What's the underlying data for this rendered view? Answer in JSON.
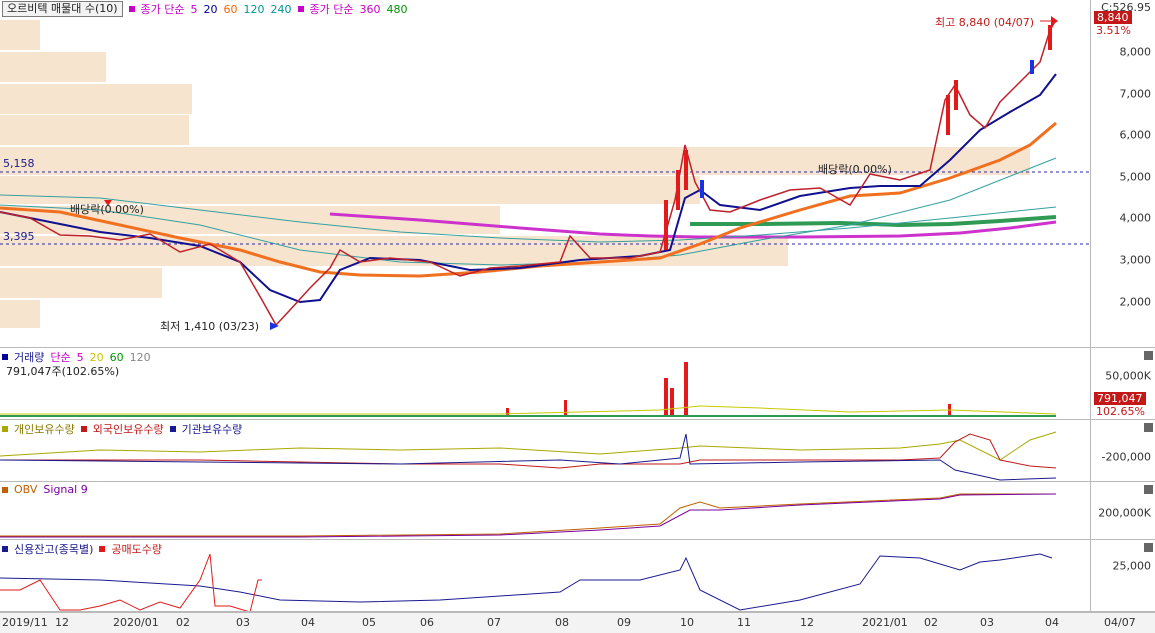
{
  "main": {
    "title_button": "오르비텍 매물대 수(10)",
    "ma_label": "종가 단순",
    "ma_periods": [
      "5",
      "20",
      "60",
      "120",
      "240"
    ],
    "ma_long_label": "종가 단순",
    "ma_long_periods": [
      "360",
      "480"
    ],
    "ma_colors": [
      "#c800c8",
      "#000096",
      "#ff6400",
      "#009696",
      "#009696"
    ],
    "ma_long_colors": [
      "#c800c8",
      "#009600"
    ],
    "corner_label": "C:526.95",
    "yticks": [
      "8,000",
      "7,000",
      "6,000",
      "5,000",
      "4,000",
      "3,000",
      "2,000"
    ],
    "price_badge": "8,840",
    "pct_label": "3.51%",
    "high_label": "최고 8,840 (04/07)",
    "low_label": "최저 1,410 (03/23)",
    "dividend_label_1": "배당락(0.00%)",
    "dividend_label_2": "배당락(0.00%)",
    "line_5158": "5,158",
    "line_3395": "3,395"
  },
  "volume": {
    "label": "거래량",
    "ma_label": "단순",
    "ma_periods": [
      "5",
      "20",
      "60",
      "120"
    ],
    "value_line": "791,047주(102.65%)",
    "ytick": "50,000K",
    "badge": "791,047",
    "badge_pct": "102.65%"
  },
  "holders": {
    "labels": [
      "개인보유수량",
      "외국인보유수량",
      "기관보유수량"
    ],
    "ytick": "-200,000"
  },
  "obv": {
    "labels": [
      "OBV",
      "Signal 9"
    ],
    "ytick": "200,000K"
  },
  "credit": {
    "labels": [
      "신용잔고(종목별)",
      "공매도수량"
    ],
    "ytick": "25,000"
  },
  "xaxis": {
    "labels": [
      "2019/11",
      "12",
      "2020/01",
      "02",
      "03",
      "04",
      "05",
      "06",
      "07",
      "08",
      "09",
      "10",
      "11",
      "12",
      "2021/01",
      "02",
      "03",
      "04",
      "04/07"
    ]
  },
  "chart_data": {
    "type": "line",
    "title": "오르비텍 매물대 수(10)",
    "x": [
      "2019/11",
      "12",
      "2020/01",
      "02",
      "03",
      "04",
      "05",
      "06",
      "07",
      "08",
      "09",
      "10",
      "11",
      "12",
      "2021/01",
      "02",
      "03",
      "04"
    ],
    "series": [
      {
        "name": "종가",
        "values": [
          4100,
          3600,
          3500,
          3300,
          1500,
          3000,
          3150,
          3000,
          2800,
          3100,
          3200,
          4500,
          4200,
          4700,
          4900,
          6800,
          6800,
          8840
        ]
      },
      {
        "name": "종가 단순 60",
        "values": [
          3950,
          3750,
          3500,
          3300,
          2700,
          2600,
          2700,
          2750,
          2800,
          2900,
          3050,
          3500,
          3900,
          4300,
          4600,
          5200,
          5700,
          6300
        ]
      }
    ],
    "ylim": [
      1000,
      9200
    ],
    "annotations": [
      "최고 8,840 (04/07)",
      "최저 1,410 (03/23)",
      "배당락(0.00%)",
      "5,158",
      "3,395"
    ]
  }
}
